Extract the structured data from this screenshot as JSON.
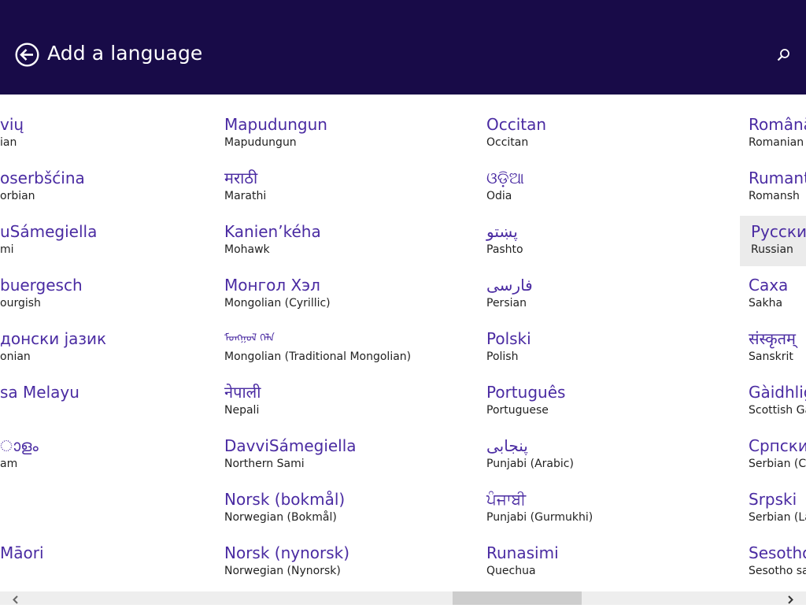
{
  "header": {
    "title": "Add a language",
    "back_icon": "back-arrow-icon",
    "search_icon": "search-icon"
  },
  "colors": {
    "header_bg": "#180b48",
    "accent_text": "#4a2ba2",
    "selected_bg": "#ebebeb"
  },
  "columns": [
    {
      "items": [
        {
          "native": "vių",
          "english": "ian"
        },
        {
          "native": "oserbšćina",
          "english": "orbian"
        },
        {
          "native": "uSámegiella",
          "english": "mi"
        },
        {
          "native": "buergesch",
          "english": "ourgish"
        },
        {
          "native": "донски јазик",
          "english": "onian"
        },
        {
          "native": "sa Melayu",
          "english": ""
        },
        {
          "native": "ാളം",
          "english": "am"
        },
        {
          "native": "",
          "english": ""
        },
        {
          "native": "Māori",
          "english": ""
        }
      ]
    },
    {
      "items": [
        {
          "native": "Mapudungun",
          "english": "Mapudungun"
        },
        {
          "native": "मराठी",
          "english": "Marathi"
        },
        {
          "native": "Kanien’kéha",
          "english": "Mohawk"
        },
        {
          "native": "Монгол Хэл",
          "english": "Mongolian (Cyrillic)"
        },
        {
          "native": "ᠮᠣᠩᠭᠣᠯ ᠬᠡᠯᠡ",
          "english": "Mongolian (Traditional Mongolian)"
        },
        {
          "native": "नेपाली",
          "english": "Nepali"
        },
        {
          "native": "DavviSámegiella",
          "english": "Northern Sami"
        },
        {
          "native": "Norsk (bokmål)",
          "english": "Norwegian (Bokmål)"
        },
        {
          "native": "Norsk (nynorsk)",
          "english": "Norwegian (Nynorsk)"
        }
      ]
    },
    {
      "items": [
        {
          "native": "Occitan",
          "english": "Occitan"
        },
        {
          "native": "ଓଡ଼ିଆ",
          "english": "Odia"
        },
        {
          "native": "پښتو",
          "english": "Pashto"
        },
        {
          "native": "فارسی",
          "english": "Persian"
        },
        {
          "native": "Polski",
          "english": "Polish"
        },
        {
          "native": "Português",
          "english": "Portuguese"
        },
        {
          "native": "پنجابی",
          "english": "Punjabi (Arabic)"
        },
        {
          "native": "ਪੰਜਾਬੀ",
          "english": "Punjabi (Gurmukhi)"
        },
        {
          "native": "Runasimi",
          "english": "Quechua"
        }
      ]
    },
    {
      "items": [
        {
          "native": "Română",
          "english": "Romanian"
        },
        {
          "native": "Rumantsch",
          "english": "Romansh"
        },
        {
          "native": "Русский",
          "english": "Russian"
        },
        {
          "native": "Саха",
          "english": "Sakha"
        },
        {
          "native": "संस्कृतम्",
          "english": "Sanskrit"
        },
        {
          "native": "Gàidhlig",
          "english": "Scottish Gaelic"
        },
        {
          "native": "Српски",
          "english": "Serbian (Cyrillic)"
        },
        {
          "native": "Srpski",
          "english": "Serbian (Latin)"
        },
        {
          "native": "Sesotho",
          "english": "Sesotho sa Leboa"
        }
      ]
    }
  ],
  "selected": {
    "column": 3,
    "item": 2
  },
  "scrollbar": {
    "left_icon": "chevron-left-icon",
    "right_icon": "chevron-right-icon",
    "position_fraction": 0.56
  }
}
